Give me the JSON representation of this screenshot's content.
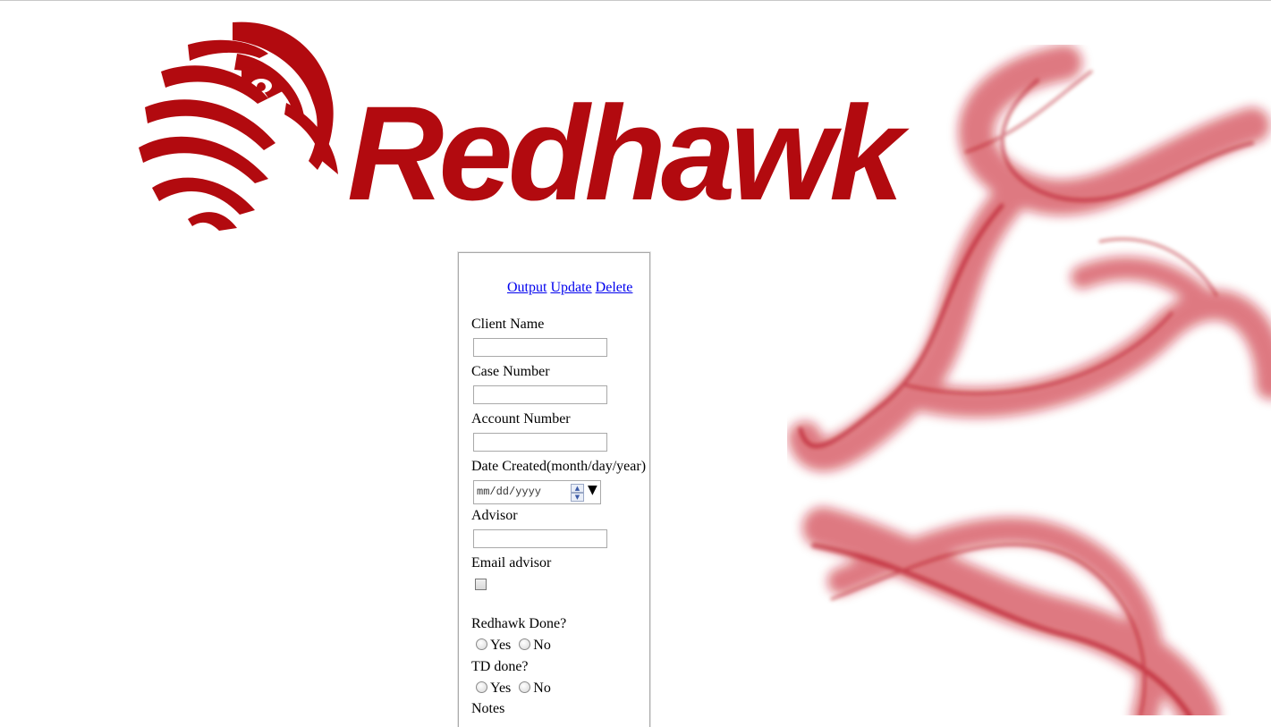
{
  "brand": {
    "name": "Redhawk"
  },
  "actions": {
    "output": "Output",
    "update": "Update",
    "delete": "Delete"
  },
  "form": {
    "client_name": {
      "label": "Client Name",
      "value": ""
    },
    "case_number": {
      "label": "Case Number",
      "value": ""
    },
    "account_number": {
      "label": "Account Number",
      "value": ""
    },
    "date_created": {
      "label": "Date Created(month/day/year)",
      "placeholder": "mm/dd/yyyy"
    },
    "advisor": {
      "label": "Advisor",
      "value": ""
    },
    "email_advisor": {
      "label": "Email advisor",
      "checked": false
    },
    "redhawk_done": {
      "label": "Redhawk Done?",
      "yes": "Yes",
      "no": "No"
    },
    "td_done": {
      "label": "TD done?",
      "yes": "Yes",
      "no": "No"
    },
    "notes": {
      "label": "Notes"
    }
  },
  "colors": {
    "brand_red": "#b20a0f",
    "link_blue": "#0000ee"
  },
  "icons": {
    "logo": "hawk-head-icon",
    "backdrop": "red-smoke-image",
    "date_dropdown": "triangle-down-icon"
  }
}
